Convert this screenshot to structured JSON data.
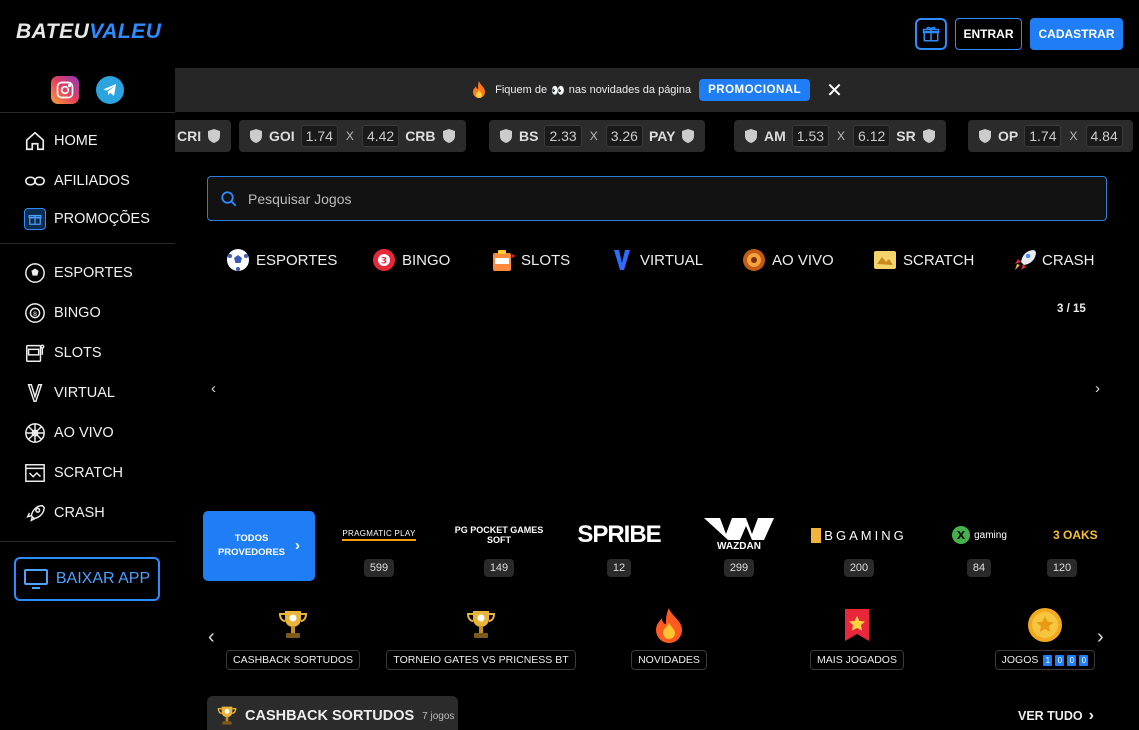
{
  "header": {
    "logo_part1": "BATEU",
    "logo_part2": "VALEU",
    "entrar_label": "ENTRAR",
    "cadastrar_label": "CADASTRAR",
    "accent_color": "#1f7ef5"
  },
  "sidebar": {
    "top_items": [
      {
        "label": "HOME",
        "icon": "home-icon"
      },
      {
        "label": "AFILIADOS",
        "icon": "link-icon"
      },
      {
        "label": "PROMOÇÕES",
        "icon": "gift-icon"
      }
    ],
    "game_items": [
      {
        "label": "ESPORTES",
        "icon": "soccer-ball-icon"
      },
      {
        "label": "BINGO",
        "icon": "bingo-ball-icon"
      },
      {
        "label": "SLOTS",
        "icon": "slot-machine-icon"
      },
      {
        "label": "VIRTUAL",
        "icon": "virtual-v-icon"
      },
      {
        "label": "AO VIVO",
        "icon": "roulette-icon"
      },
      {
        "label": "SCRATCH",
        "icon": "scratch-card-icon"
      },
      {
        "label": "CRASH",
        "icon": "rocket-icon"
      }
    ],
    "baixar_label": "BAIXAR APP"
  },
  "promo_bar": {
    "text_before": "Fiquem de",
    "text_after": "nas novidades da página",
    "button_label": "PROMOCIONAL",
    "close_symbol": "✕"
  },
  "ticker": [
    {
      "home": "CRI",
      "odd1": "",
      "odd2": "",
      "away": ""
    },
    {
      "home": "GOI",
      "odd1": "1.74",
      "odd2": "4.42",
      "away": "CRB"
    },
    {
      "home": "BS",
      "odd1": "2.33",
      "odd2": "3.26",
      "away": "PAY"
    },
    {
      "home": "AM",
      "odd1": "1.53",
      "odd2": "6.12",
      "away": "SR"
    },
    {
      "home": "OP",
      "odd1": "1.74",
      "odd2": "4.84",
      "away": ""
    }
  ],
  "ticker_x": "X",
  "search": {
    "placeholder": "Pesquisar Jogos"
  },
  "categories": [
    {
      "label": "ESPORTES",
      "icon": "soccer-ball-icon"
    },
    {
      "label": "BINGO",
      "icon": "bingo-ball-icon"
    },
    {
      "label": "SLOTS",
      "icon": "slot-machine-icon"
    },
    {
      "label": "VIRTUAL",
      "icon": "virtual-v-icon"
    },
    {
      "label": "AO VIVO",
      "icon": "roulette-icon"
    },
    {
      "label": "SCRATCH",
      "icon": "scratch-card-icon"
    },
    {
      "label": "CRASH",
      "icon": "rocket-icon"
    }
  ],
  "carousel": {
    "counter": "3 / 15",
    "prev": "‹",
    "next": "›"
  },
  "providers": {
    "all_label_line1": "TODOS",
    "all_label_line2": "PROVEDORES",
    "items": [
      {
        "name": "PRAGMATIC PLAY",
        "count": "599"
      },
      {
        "name": "PG POCKET GAMES SOFT",
        "count": "149"
      },
      {
        "name": "SPRIBE",
        "count": "12"
      },
      {
        "name": "WAZDAN",
        "count": "299"
      },
      {
        "name": "BGAMING",
        "count": "200"
      },
      {
        "name": "gaming",
        "count": "84"
      },
      {
        "name": "3 OAKS",
        "count": "120"
      }
    ]
  },
  "collections": {
    "prev": "‹",
    "next": "›",
    "items": [
      {
        "label": "CASHBACK SORTUDOS",
        "icon": "trophy-icon"
      },
      {
        "label": "TORNEIO GATES VS PRICNESS BT",
        "icon": "trophy-icon"
      },
      {
        "label": "NOVIDADES",
        "icon": "fire-icon"
      },
      {
        "label": "MAIS JOGADOS",
        "icon": "star-bookmark-icon"
      },
      {
        "label": "JOGOS",
        "icon": "gold-coin-icon",
        "digits": [
          "1",
          "0",
          "0",
          "0"
        ]
      }
    ]
  },
  "section": {
    "title": "CASHBACK SORTUDOS",
    "count": "7 jogos",
    "see_all": "VER TUDO"
  }
}
